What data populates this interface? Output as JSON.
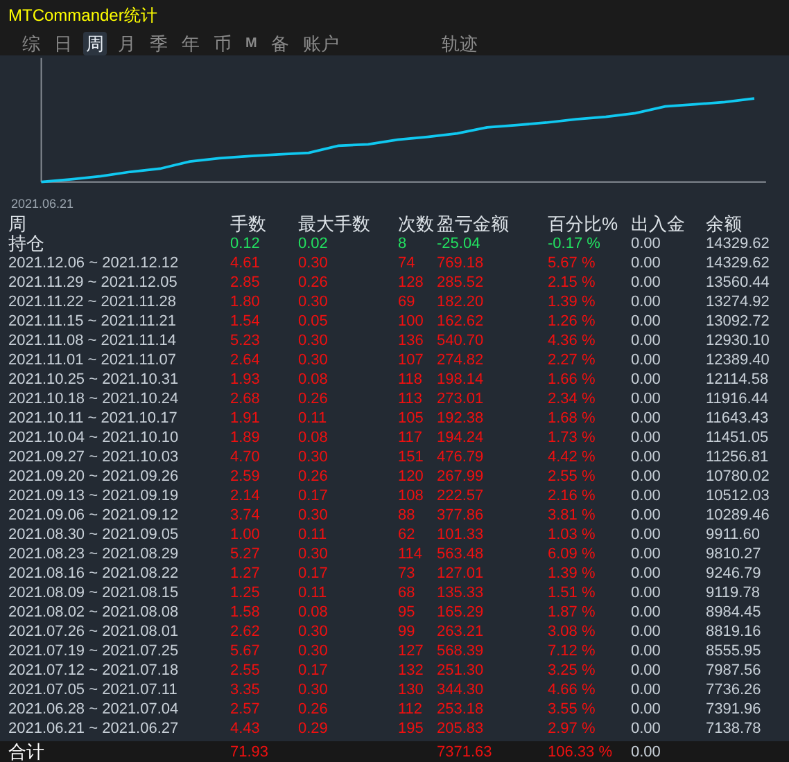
{
  "window": {
    "title": "MTCommander统计"
  },
  "tabs": [
    {
      "label": "综",
      "selected": false
    },
    {
      "label": "日",
      "selected": false
    },
    {
      "label": "周",
      "selected": true
    },
    {
      "label": "月",
      "selected": false
    },
    {
      "label": "季",
      "selected": false
    },
    {
      "label": "年",
      "selected": false
    },
    {
      "label": "币",
      "selected": false
    },
    {
      "label": "M",
      "selected": false,
      "kind": "small"
    },
    {
      "label": "备",
      "selected": false
    },
    {
      "label": "账户",
      "selected": false
    }
  ],
  "track_tab": {
    "label": "轨迹",
    "selected": false
  },
  "chart": {
    "start_label": "2021.06.21"
  },
  "table": {
    "columns": [
      "周",
      "手数",
      "最大手数",
      "次数",
      "盈亏金额",
      "百分比%",
      "出入金",
      "余额"
    ],
    "rows": [
      {
        "kind": "position",
        "period": "持仓",
        "lots": "0.12",
        "max_lots": "0.02",
        "trades": "8",
        "profit": "-25.04",
        "percent": "-0.17 %",
        "deposit": "0.00",
        "balance": "14329.62"
      },
      {
        "kind": "week",
        "period": "2021.12.06 ~ 2021.12.12",
        "lots": "4.61",
        "max_lots": "0.30",
        "trades": "74",
        "profit": "769.18",
        "percent": "5.67 %",
        "deposit": "0.00",
        "balance": "14329.62"
      },
      {
        "kind": "week",
        "period": "2021.11.29 ~ 2021.12.05",
        "lots": "2.85",
        "max_lots": "0.26",
        "trades": "128",
        "profit": "285.52",
        "percent": "2.15 %",
        "deposit": "0.00",
        "balance": "13560.44"
      },
      {
        "kind": "week",
        "period": "2021.11.22 ~ 2021.11.28",
        "lots": "1.80",
        "max_lots": "0.30",
        "trades": "69",
        "profit": "182.20",
        "percent": "1.39 %",
        "deposit": "0.00",
        "balance": "13274.92"
      },
      {
        "kind": "week",
        "period": "2021.11.15 ~ 2021.11.21",
        "lots": "1.54",
        "max_lots": "0.05",
        "trades": "100",
        "profit": "162.62",
        "percent": "1.26 %",
        "deposit": "0.00",
        "balance": "13092.72"
      },
      {
        "kind": "week",
        "period": "2021.11.08 ~ 2021.11.14",
        "lots": "5.23",
        "max_lots": "0.30",
        "trades": "136",
        "profit": "540.70",
        "percent": "4.36 %",
        "deposit": "0.00",
        "balance": "12930.10"
      },
      {
        "kind": "week",
        "period": "2021.11.01 ~ 2021.11.07",
        "lots": "2.64",
        "max_lots": "0.30",
        "trades": "107",
        "profit": "274.82",
        "percent": "2.27 %",
        "deposit": "0.00",
        "balance": "12389.40"
      },
      {
        "kind": "week",
        "period": "2021.10.25 ~ 2021.10.31",
        "lots": "1.93",
        "max_lots": "0.08",
        "trades": "118",
        "profit": "198.14",
        "percent": "1.66 %",
        "deposit": "0.00",
        "balance": "12114.58"
      },
      {
        "kind": "week",
        "period": "2021.10.18 ~ 2021.10.24",
        "lots": "2.68",
        "max_lots": "0.26",
        "trades": "113",
        "profit": "273.01",
        "percent": "2.34 %",
        "deposit": "0.00",
        "balance": "11916.44"
      },
      {
        "kind": "week",
        "period": "2021.10.11 ~ 2021.10.17",
        "lots": "1.91",
        "max_lots": "0.11",
        "trades": "105",
        "profit": "192.38",
        "percent": "1.68 %",
        "deposit": "0.00",
        "balance": "11643.43"
      },
      {
        "kind": "week",
        "period": "2021.10.04 ~ 2021.10.10",
        "lots": "1.89",
        "max_lots": "0.08",
        "trades": "117",
        "profit": "194.24",
        "percent": "1.73 %",
        "deposit": "0.00",
        "balance": "11451.05"
      },
      {
        "kind": "week",
        "period": "2021.09.27 ~ 2021.10.03",
        "lots": "4.70",
        "max_lots": "0.30",
        "trades": "151",
        "profit": "476.79",
        "percent": "4.42 %",
        "deposit": "0.00",
        "balance": "11256.81"
      },
      {
        "kind": "week",
        "period": "2021.09.20 ~ 2021.09.26",
        "lots": "2.59",
        "max_lots": "0.26",
        "trades": "120",
        "profit": "267.99",
        "percent": "2.55 %",
        "deposit": "0.00",
        "balance": "10780.02"
      },
      {
        "kind": "week",
        "period": "2021.09.13 ~ 2021.09.19",
        "lots": "2.14",
        "max_lots": "0.17",
        "trades": "108",
        "profit": "222.57",
        "percent": "2.16 %",
        "deposit": "0.00",
        "balance": "10512.03"
      },
      {
        "kind": "week",
        "period": "2021.09.06 ~ 2021.09.12",
        "lots": "3.74",
        "max_lots": "0.30",
        "trades": "88",
        "profit": "377.86",
        "percent": "3.81 %",
        "deposit": "0.00",
        "balance": "10289.46"
      },
      {
        "kind": "week",
        "period": "2021.08.30 ~ 2021.09.05",
        "lots": "1.00",
        "max_lots": "0.11",
        "trades": "62",
        "profit": "101.33",
        "percent": "1.03 %",
        "deposit": "0.00",
        "balance": "9911.60"
      },
      {
        "kind": "week",
        "period": "2021.08.23 ~ 2021.08.29",
        "lots": "5.27",
        "max_lots": "0.30",
        "trades": "114",
        "profit": "563.48",
        "percent": "6.09 %",
        "deposit": "0.00",
        "balance": "9810.27"
      },
      {
        "kind": "week",
        "period": "2021.08.16 ~ 2021.08.22",
        "lots": "1.27",
        "max_lots": "0.17",
        "trades": "73",
        "profit": "127.01",
        "percent": "1.39 %",
        "deposit": "0.00",
        "balance": "9246.79"
      },
      {
        "kind": "week",
        "period": "2021.08.09 ~ 2021.08.15",
        "lots": "1.25",
        "max_lots": "0.11",
        "trades": "68",
        "profit": "135.33",
        "percent": "1.51 %",
        "deposit": "0.00",
        "balance": "9119.78"
      },
      {
        "kind": "week",
        "period": "2021.08.02 ~ 2021.08.08",
        "lots": "1.58",
        "max_lots": "0.08",
        "trades": "95",
        "profit": "165.29",
        "percent": "1.87 %",
        "deposit": "0.00",
        "balance": "8984.45"
      },
      {
        "kind": "week",
        "period": "2021.07.26 ~ 2021.08.01",
        "lots": "2.62",
        "max_lots": "0.30",
        "trades": "99",
        "profit": "263.21",
        "percent": "3.08 %",
        "deposit": "0.00",
        "balance": "8819.16"
      },
      {
        "kind": "week",
        "period": "2021.07.19 ~ 2021.07.25",
        "lots": "5.67",
        "max_lots": "0.30",
        "trades": "127",
        "profit": "568.39",
        "percent": "7.12 %",
        "deposit": "0.00",
        "balance": "8555.95"
      },
      {
        "kind": "week",
        "period": "2021.07.12 ~ 2021.07.18",
        "lots": "2.55",
        "max_lots": "0.17",
        "trades": "132",
        "profit": "251.30",
        "percent": "3.25 %",
        "deposit": "0.00",
        "balance": "7987.56"
      },
      {
        "kind": "week",
        "period": "2021.07.05 ~ 2021.07.11",
        "lots": "3.35",
        "max_lots": "0.30",
        "trades": "130",
        "profit": "344.30",
        "percent": "4.66 %",
        "deposit": "0.00",
        "balance": "7736.26"
      },
      {
        "kind": "week",
        "period": "2021.06.28 ~ 2021.07.04",
        "lots": "2.57",
        "max_lots": "0.26",
        "trades": "112",
        "profit": "253.18",
        "percent": "3.55 %",
        "deposit": "0.00",
        "balance": "7391.96"
      },
      {
        "kind": "week",
        "period": "2021.06.21 ~ 2021.06.27",
        "lots": "4.43",
        "max_lots": "0.29",
        "trades": "195",
        "profit": "205.83",
        "percent": "2.97 %",
        "deposit": "0.00",
        "balance": "7138.78"
      }
    ],
    "total": {
      "period": "合计",
      "lots": "71.93",
      "profit": "7371.63",
      "percent": "106.33 %",
      "deposit": "0.00"
    }
  }
}
